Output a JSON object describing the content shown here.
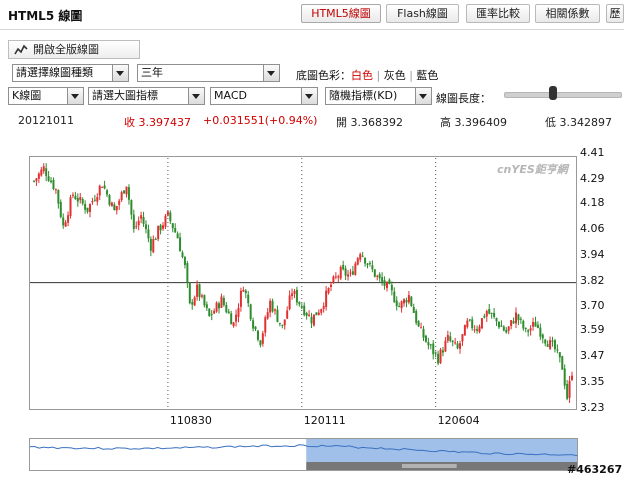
{
  "header": {
    "title": "HTML5 線圖",
    "tabs": [
      {
        "label": "HTML5線圖",
        "active": true
      },
      {
        "label": "Flash線圖",
        "active": false
      },
      {
        "label": "匯率比較",
        "active": false
      },
      {
        "label": "相關係數",
        "active": false
      },
      {
        "label": "歷",
        "active": false
      }
    ]
  },
  "toolbar": {
    "open_full_label": "開啟全版線圖",
    "chart_type_select": "請選擇線圖種類",
    "period_select": "三年",
    "bg_color_label": "底圖色彩：",
    "bg_colors": [
      "白色",
      "灰色",
      "藍色"
    ],
    "k_select": "K線圖",
    "main_indicator_select": "請選大圖指標",
    "macd_select": "MACD",
    "sub_indicator_select": "隨機指標(KD)",
    "length_label": "線圖長度：",
    "length_level": 0.42
  },
  "quote": {
    "date": "20121011",
    "close": "收 3.397437",
    "change": "+0.031551(+0.94%)",
    "open": "開 3.368392",
    "high": "高 3.396409",
    "low": "低 3.342897"
  },
  "watermark": "cnYES鉅亨網",
  "stamp": "#463267",
  "colors": {
    "up": "#e03030",
    "down": "#2e8b2e",
    "accent": "#c00000",
    "nav_fill": "#8fb5e6",
    "nav_line": "#3a70c0"
  },
  "chart_data": {
    "type": "candlestick",
    "y_ticks": [
      "4.41",
      "4.29",
      "4.18",
      "4.06",
      "3.94",
      "3.82",
      "3.70",
      "3.59",
      "3.47",
      "3.35",
      "3.23"
    ],
    "ylim": [
      3.23,
      4.41
    ],
    "x_ticks": [
      {
        "label": "110830",
        "index": 55
      },
      {
        "label": "120111",
        "index": 110
      },
      {
        "label": "120604",
        "index": 165
      }
    ],
    "reference_line": 3.81,
    "count": 222,
    "close_path": [
      [
        0,
        4.28
      ],
      [
        4,
        4.34
      ],
      [
        9,
        4.24
      ],
      [
        12,
        4.07
      ],
      [
        16,
        4.22
      ],
      [
        22,
        4.15
      ],
      [
        28,
        4.27
      ],
      [
        33,
        4.14
      ],
      [
        38,
        4.27
      ],
      [
        41,
        4.05
      ],
      [
        44,
        4.12
      ],
      [
        48,
        3.98
      ],
      [
        51,
        4.05
      ],
      [
        55,
        4.12
      ],
      [
        59,
        4.02
      ],
      [
        62,
        3.88
      ],
      [
        64,
        3.7
      ],
      [
        67,
        3.78
      ],
      [
        72,
        3.65
      ],
      [
        77,
        3.73
      ],
      [
        82,
        3.62
      ],
      [
        86,
        3.8
      ],
      [
        90,
        3.62
      ],
      [
        93,
        3.54
      ],
      [
        97,
        3.72
      ],
      [
        102,
        3.6
      ],
      [
        106,
        3.77
      ],
      [
        110,
        3.7
      ],
      [
        114,
        3.64
      ],
      [
        118,
        3.7
      ],
      [
        122,
        3.8
      ],
      [
        126,
        3.86
      ],
      [
        130,
        3.84
      ],
      [
        134,
        3.96
      ],
      [
        138,
        3.88
      ],
      [
        142,
        3.82
      ],
      [
        146,
        3.78
      ],
      [
        150,
        3.7
      ],
      [
        154,
        3.75
      ],
      [
        158,
        3.6
      ],
      [
        162,
        3.52
      ],
      [
        166,
        3.46
      ],
      [
        170,
        3.55
      ],
      [
        174,
        3.5
      ],
      [
        178,
        3.62
      ],
      [
        182,
        3.6
      ],
      [
        186,
        3.68
      ],
      [
        190,
        3.63
      ],
      [
        194,
        3.58
      ],
      [
        198,
        3.66
      ],
      [
        202,
        3.58
      ],
      [
        206,
        3.62
      ],
      [
        210,
        3.55
      ],
      [
        214,
        3.5
      ],
      [
        217,
        3.42
      ],
      [
        219,
        3.28
      ],
      [
        221,
        3.4
      ]
    ],
    "navigator_selection": [
      0.505,
      1.0
    ]
  }
}
